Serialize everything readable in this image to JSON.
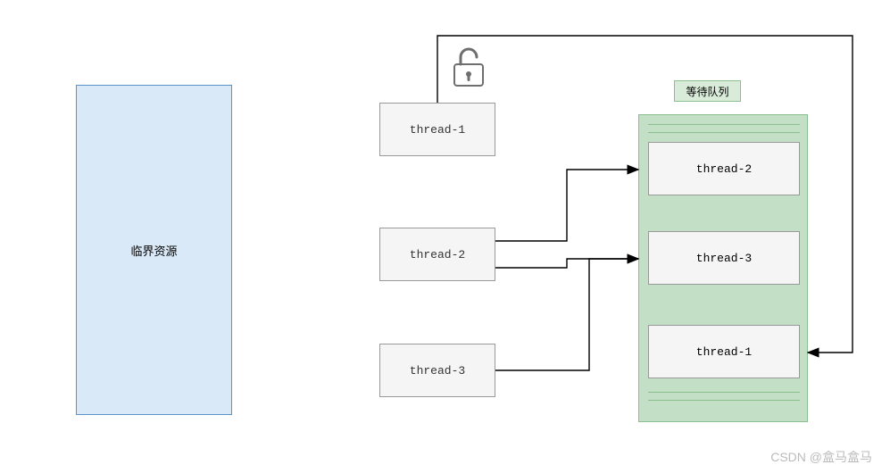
{
  "critical_resource": {
    "label": "临界资源"
  },
  "lock": {
    "state": "unlocked",
    "icon_name": "lock-open-icon"
  },
  "threads": {
    "t1": "thread-1",
    "t2": "thread-2",
    "t3": "thread-3"
  },
  "wait_queue": {
    "label": "等待队列",
    "items": [
      "thread-2",
      "thread-3",
      "thread-1"
    ]
  },
  "arrows": [
    {
      "from": "thread-2",
      "to": "queue-slot-1"
    },
    {
      "from": "thread-2",
      "to": "queue-slot-2"
    },
    {
      "from": "thread-3",
      "to": "queue-slot-2"
    },
    {
      "from": "thread-1",
      "to": "queue-slot-3",
      "path": "over-top"
    }
  ],
  "watermark": "CSDN @盒马盒马",
  "colors": {
    "critical_bg": "#d9e9f8",
    "critical_border": "#5a93c7",
    "queue_bg": "#c3e0c6",
    "queue_border": "#8cbf90",
    "box_bg": "#f5f5f5",
    "box_border": "#999999"
  },
  "chart_data": {
    "type": "diagram",
    "title": "",
    "description": "Threads entering a wait queue while the lock is open",
    "nodes": [
      {
        "id": "critical",
        "label": "临界资源"
      },
      {
        "id": "lock",
        "label": "open-lock"
      },
      {
        "id": "t1",
        "label": "thread-1"
      },
      {
        "id": "t2",
        "label": "thread-2"
      },
      {
        "id": "t3",
        "label": "thread-3"
      },
      {
        "id": "queue",
        "label": "等待队列",
        "items": [
          "thread-2",
          "thread-3",
          "thread-1"
        ]
      }
    ],
    "edges": [
      {
        "from": "t2",
        "to": "queue[0]"
      },
      {
        "from": "t2",
        "to": "queue[1]"
      },
      {
        "from": "t3",
        "to": "queue[1]"
      },
      {
        "from": "t1",
        "to": "queue[2]"
      }
    ]
  }
}
